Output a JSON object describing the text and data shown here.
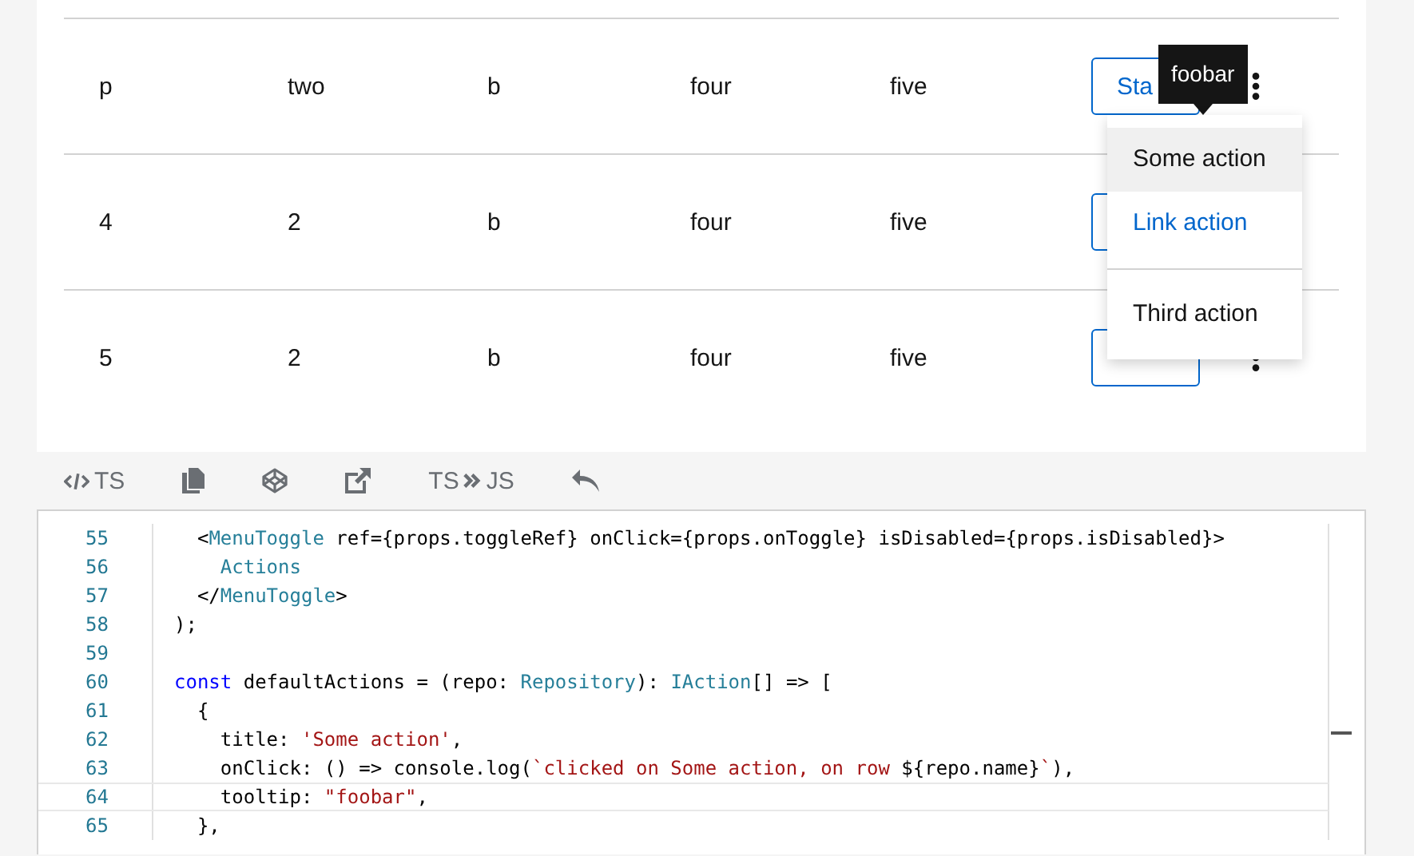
{
  "table": {
    "rows": [
      {
        "cells": [
          "p",
          "two",
          "b",
          "four",
          "five"
        ],
        "action": "Sta",
        "kebab": true
      },
      {
        "cells": [
          "4",
          "2",
          "b",
          "four",
          "five"
        ],
        "kebab": false
      },
      {
        "cells": [
          "5",
          "2",
          "b",
          "four",
          "five"
        ],
        "kebab": true
      }
    ]
  },
  "tooltip": "foobar",
  "menu": {
    "items": [
      {
        "kind": "item",
        "label": "Some action",
        "selected": true
      },
      {
        "kind": "link",
        "label": "Link action",
        "selected": false
      },
      {
        "kind": "divider"
      },
      {
        "kind": "item",
        "label": "Third action",
        "selected": false
      }
    ]
  },
  "toolbar": [
    {
      "kind": "code",
      "label": "TS"
    },
    {
      "kind": "copy"
    },
    {
      "kind": "codepen"
    },
    {
      "kind": "external"
    },
    {
      "kind": "convert",
      "from": "TS",
      "to": "JS"
    },
    {
      "kind": "undo"
    }
  ],
  "code": {
    "lines": [
      {
        "num": "55",
        "active": false,
        "tokens": [
          {
            "kind": "plain",
            "t": "  <"
          },
          {
            "kind": "tag",
            "t": "MenuToggle"
          },
          {
            "kind": "plain",
            "t": " ref={props.toggleRef} onClick={props.onToggle} isDisabled={props.isDisabled}>"
          }
        ]
      },
      {
        "num": "56",
        "active": false,
        "tokens": [
          {
            "kind": "tag",
            "t": "    Actions"
          }
        ]
      },
      {
        "num": "57",
        "active": false,
        "tokens": [
          {
            "kind": "plain",
            "t": "  </"
          },
          {
            "kind": "tag",
            "t": "MenuToggle"
          },
          {
            "kind": "plain",
            "t": ">"
          }
        ]
      },
      {
        "num": "58",
        "active": false,
        "tokens": [
          {
            "kind": "plain",
            "t": ");"
          }
        ]
      },
      {
        "num": "59",
        "active": false
      },
      {
        "num": "60",
        "active": false,
        "tokens": [
          {
            "kind": "keyword",
            "t": "const"
          },
          {
            "kind": "plain",
            "t": " defaultActions = (repo: "
          },
          {
            "kind": "type",
            "t": "Repository"
          },
          {
            "kind": "plain",
            "t": "): "
          },
          {
            "kind": "type",
            "t": "IAction"
          },
          {
            "kind": "plain",
            "t": "[] => ["
          }
        ]
      },
      {
        "num": "61",
        "active": false,
        "tokens": [
          {
            "kind": "plain",
            "t": "  {"
          }
        ]
      },
      {
        "num": "62",
        "active": false,
        "tokens": [
          {
            "kind": "plain",
            "t": "    title: "
          },
          {
            "kind": "string",
            "t": "'Some action'"
          },
          {
            "kind": "plain",
            "t": ","
          }
        ]
      },
      {
        "num": "63",
        "active": false,
        "tokens": [
          {
            "kind": "plain",
            "t": "    onClick: () => console.log("
          },
          {
            "kind": "string",
            "t": "`clicked on Some action, on row "
          },
          {
            "kind": "plain",
            "t": "${repo.name}"
          },
          {
            "kind": "string",
            "t": "`"
          },
          {
            "kind": "plain",
            "t": "),"
          }
        ]
      },
      {
        "num": "64",
        "active": true,
        "tokens": [
          {
            "kind": "plain",
            "t": "    tooltip: "
          },
          {
            "kind": "string",
            "t": "\"foobar\""
          },
          {
            "kind": "plain",
            "t": ","
          }
        ]
      },
      {
        "num": "65",
        "active": false,
        "tokens": [
          {
            "kind": "plain",
            "t": "  },"
          }
        ]
      }
    ]
  }
}
